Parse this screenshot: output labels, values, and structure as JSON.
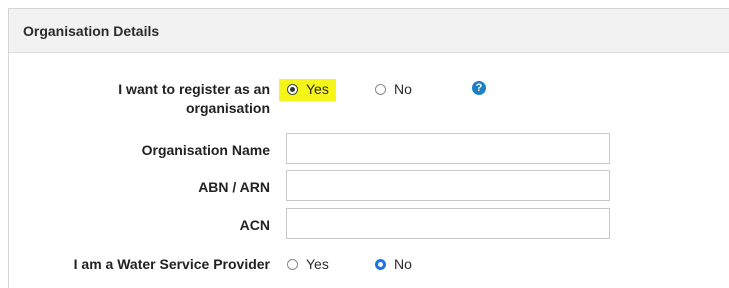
{
  "panel": {
    "title": "Organisation Details"
  },
  "fields": {
    "register_label_line1": "I want to register as an",
    "register_label_line2": "organisation",
    "register_options": [
      {
        "label": "Yes",
        "checked": true
      },
      {
        "label": "No",
        "checked": false
      }
    ],
    "help_icon": "?",
    "org_name_label": "Organisation Name",
    "org_name_value": "",
    "abn_label": "ABN / ARN",
    "abn_value": "",
    "acn_label": "ACN",
    "acn_value": "",
    "water_label": "I am a Water Service Provider",
    "water_options": [
      {
        "label": "Yes",
        "checked": false
      },
      {
        "label": "No",
        "checked": true
      }
    ]
  },
  "colors": {
    "highlight": "#f5f51a",
    "accent": "#1a73e8",
    "help_icon": "#1d7fc4",
    "header_bg": "#f2f2f2"
  },
  "icons": {
    "help": "help-icon"
  }
}
